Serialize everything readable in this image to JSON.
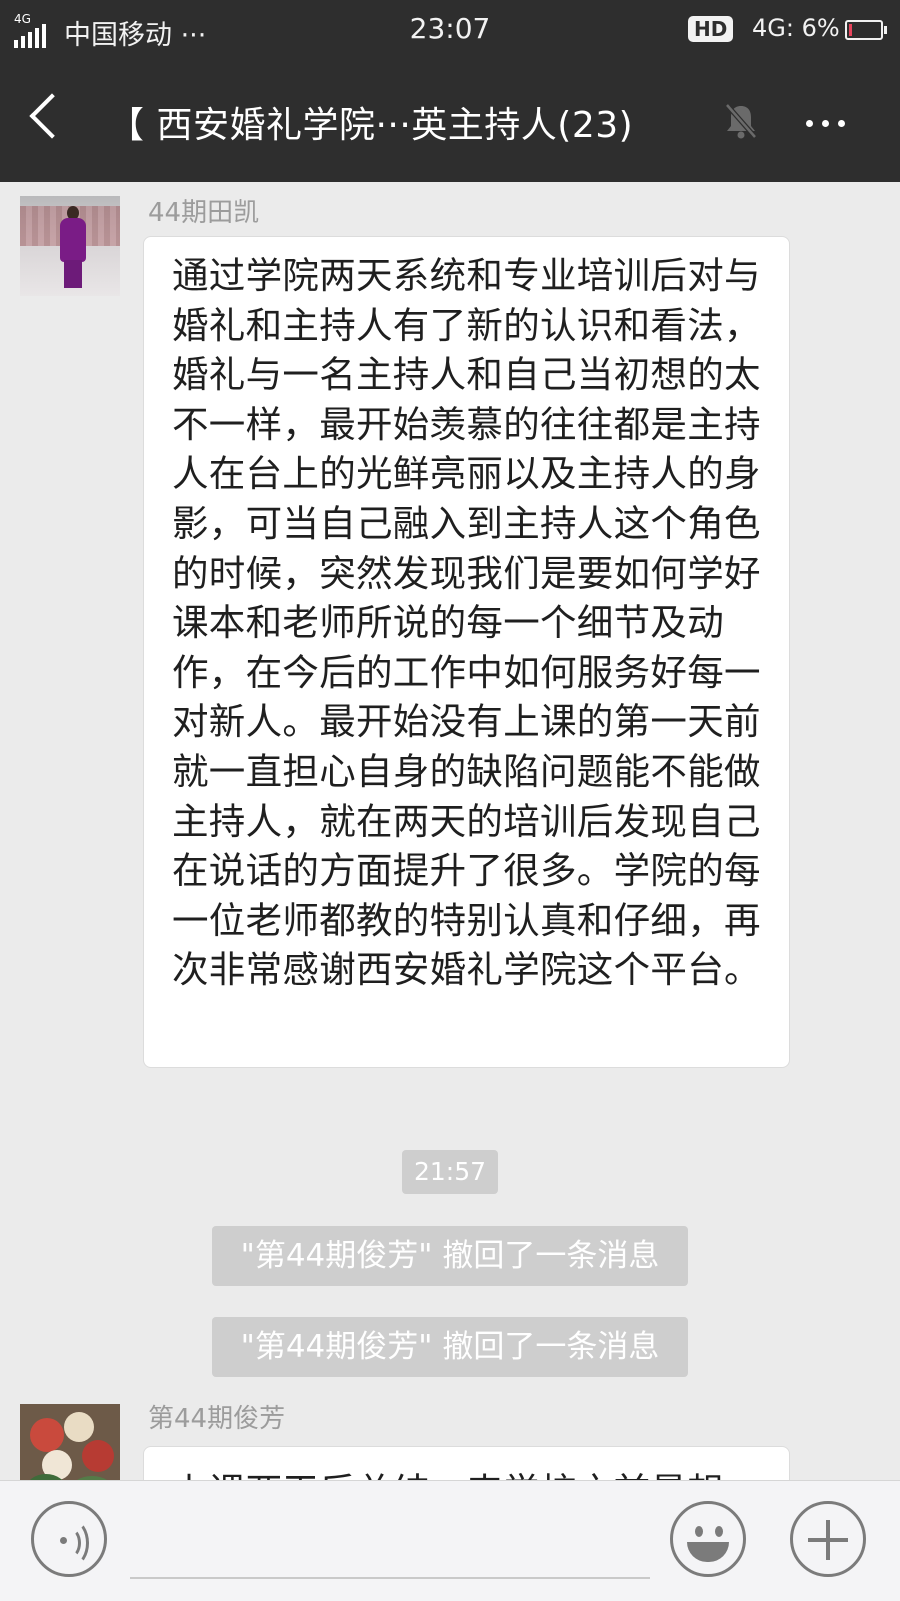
{
  "status_bar": {
    "network_type": "4G",
    "carrier": "中国移动 ···",
    "time": "23:07",
    "hd_badge": "HD",
    "network": "4G: 6%",
    "battery_percent": 6
  },
  "nav": {
    "title": "【 西安婚礼学院···英主持人(23)",
    "icons": [
      "back-arrow-icon",
      "mute-bell-icon",
      "more-dots-icon"
    ]
  },
  "messages": [
    {
      "sender": "44期田凯",
      "text": "通过学院两天系统和专业培训后对与婚礼和主持人有了新的认识和看法，婚礼与一名主持人和自己当初想的太不一样，最开始羡慕的往往都是主持人在台上的光鲜亮丽以及主持人的身影，可当自己融入到主持人这个角色的时候，突然发现我们是要如何学好课本和老师所说的每一个细节及动作，在今后的工作中如何服务好每一对新人。最开始没有上课的第一天前就一直担心自身的缺陷问题能不能做主持人，就在两天的培训后发现自己在说话的方面提升了很多。学院的每一位老师都教的特别认真和仔细，再次非常感谢西安婚礼学院这个平台。"
    },
    {
      "sender": "第44期俊芳",
      "text": "上课两天后总结，来学校之前最想"
    }
  ],
  "timestamp": "21:57",
  "system_notices": [
    "\"第44期俊芳\" 撤回了一条消息",
    "\"第44期俊芳\" 撤回了一条消息"
  ],
  "input_bar": {
    "icons": [
      "voice-icon",
      "emoji-icon",
      "plus-icon"
    ]
  }
}
